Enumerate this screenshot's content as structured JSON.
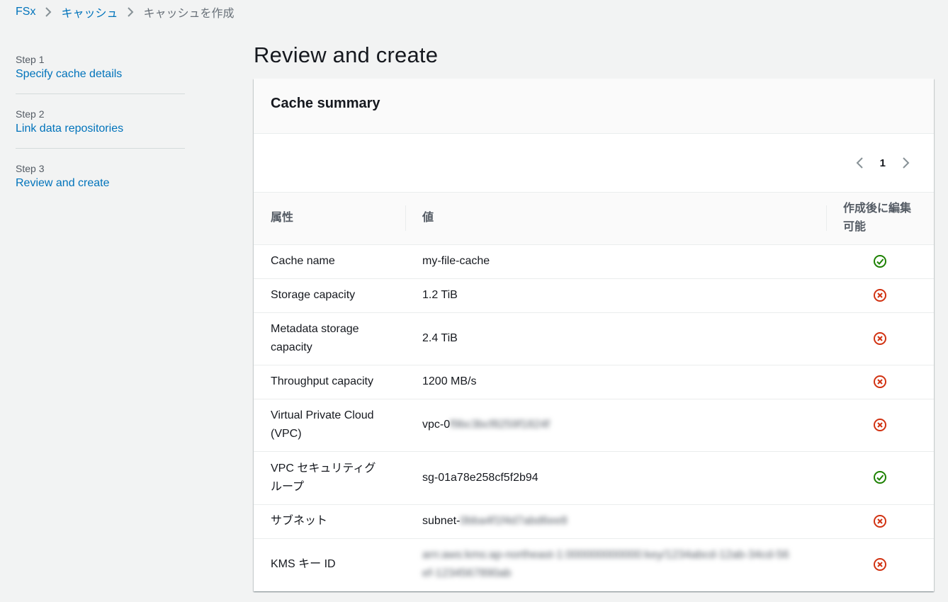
{
  "breadcrumb": {
    "items": [
      {
        "label": "FSx"
      },
      {
        "label": "キャッシュ"
      },
      {
        "label": "キャッシュを作成"
      }
    ]
  },
  "steps": [
    {
      "step": "Step 1",
      "label": "Specify cache details"
    },
    {
      "step": "Step 2",
      "label": "Link data repositories"
    },
    {
      "step": "Step 3",
      "label": "Review and create"
    }
  ],
  "page": {
    "title": "Review and create"
  },
  "summary": {
    "title": "Cache summary",
    "page_number": "1",
    "columns": {
      "attribute": "属性",
      "value": "値",
      "editable_line1": "作成後に編集",
      "editable_line2": "可能"
    },
    "rows": [
      {
        "attr": "Cache name",
        "value": "my-file-cache",
        "editable": true
      },
      {
        "attr": "Storage capacity",
        "value": "1.2 TiB",
        "editable": false
      },
      {
        "attr": "Metadata storage capacity",
        "value": "2.4 TiB",
        "editable": false
      },
      {
        "attr": "Throughput capacity",
        "value": "1200 MB/s",
        "editable": false
      },
      {
        "attr": "Virtual Private Cloud (VPC)",
        "value": "vpc-0",
        "value_hidden": "f9bc3bcf8259f1824f",
        "editable": false
      },
      {
        "attr": "VPC セキュリティグループ",
        "value": "sg-01a78e258cf5f2b94",
        "editable": true
      },
      {
        "attr": "サブネット",
        "value": "subnet-",
        "value_hidden": "0bba4f1f4d7abd6ee8",
        "editable": false
      },
      {
        "attr": "KMS キー ID",
        "value": "",
        "value_hidden": "arn:aws:kms:ap-northeast-1:000000000000:key/1234abcd-12ab-34cd-56ef-1234567890ab",
        "editable": false
      }
    ]
  },
  "colors": {
    "link": "#0073bb",
    "success": "#1d8102",
    "error": "#d13212"
  },
  "icons": {
    "editable_true": "check-circle-icon",
    "editable_false": "x-circle-icon"
  }
}
